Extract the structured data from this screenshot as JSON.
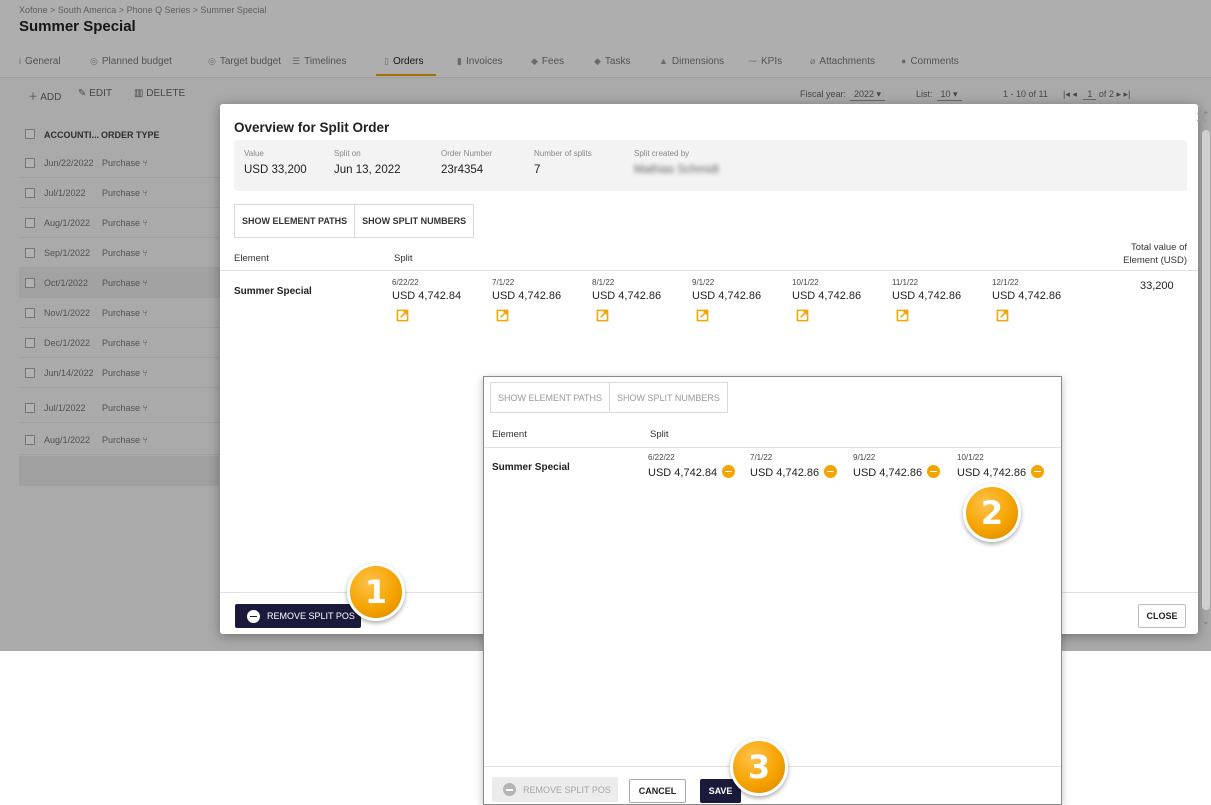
{
  "app": {
    "breadcrumb": "Xofone > South America > Phone Q Series > Summer Special",
    "title": "Summer Special",
    "tabs": [
      {
        "label": "General",
        "icon": "info-icon"
      },
      {
        "label": "Planned budget",
        "icon": "coin-icon"
      },
      {
        "label": "Target budget",
        "icon": "target-icon"
      },
      {
        "label": "Timelines",
        "icon": "timeline-icon"
      },
      {
        "label": "Orders",
        "icon": "document-icon",
        "active": true
      },
      {
        "label": "Invoices",
        "icon": "invoice-icon"
      },
      {
        "label": "Fees",
        "icon": "tag-icon"
      },
      {
        "label": "Tasks",
        "icon": "diamond-icon"
      },
      {
        "label": "Dimensions",
        "icon": "dimensions-icon"
      },
      {
        "label": "KPIs",
        "icon": "trend-icon"
      },
      {
        "label": "Attachments",
        "icon": "paperclip-icon"
      },
      {
        "label": "Comments",
        "icon": "comments-icon"
      }
    ],
    "toolbar": {
      "add": "ADD",
      "edit": "EDIT",
      "delete": "DELETE",
      "fiscal_year_label": "Fiscal year:",
      "fiscal_year_value": "2022",
      "list_label": "List:",
      "list_value": "10",
      "range": "1 - 10 of 11",
      "page": "1",
      "of_pages": "of 2"
    },
    "table": {
      "headers": [
        "ACCOUNTI...",
        "ORDER TYPE"
      ],
      "rows": [
        {
          "date": "Jun/22/2022",
          "type": "Purchase",
          "selected": false
        },
        {
          "date": "Jul/1/2022",
          "type": "Purchase",
          "selected": false
        },
        {
          "date": "Aug/1/2022",
          "type": "Purchase",
          "selected": false
        },
        {
          "date": "Sep/1/2022",
          "type": "Purchase",
          "selected": false
        },
        {
          "date": "Oct/1/2022",
          "type": "Purchase",
          "selected": true
        },
        {
          "date": "Nov/1/2022",
          "type": "Purchase",
          "selected": false
        },
        {
          "date": "Dec/1/2022",
          "type": "Purchase",
          "selected": false
        },
        {
          "date": "Jun/14/2022",
          "type": "Purchase",
          "selected": false
        },
        {
          "date": "Jul/1/2022",
          "type": "Purchase",
          "selected": false
        },
        {
          "date": "Aug/1/2022",
          "type": "Purchase",
          "selected": false
        }
      ]
    }
  },
  "dialog": {
    "title": "Overview for Split Order",
    "info": {
      "value_label": "Value",
      "value": "USD 33,200",
      "split_on_label": "Split on",
      "split_on": "Jun 13, 2022",
      "order_number_label": "Order Number",
      "order_number": "23r4354",
      "num_splits_label": "Number of splits",
      "num_splits": "7",
      "created_by_label": "Split created by",
      "created_by": "Mathias Schmidt"
    },
    "buttons": {
      "show_paths": "SHOW ELEMENT PATHS",
      "show_numbers": "SHOW SPLIT NUMBERS"
    },
    "columns": {
      "element": "Element",
      "split": "Split",
      "total_line1": "Total value of",
      "total_line2": "Element (USD)"
    },
    "row": {
      "element": "Summer Special",
      "total": "33,200",
      "splits": [
        {
          "date": "6/22/22",
          "amount": "USD 4,742.84"
        },
        {
          "date": "7/1/22",
          "amount": "USD 4,742.86"
        },
        {
          "date": "8/1/22",
          "amount": "USD 4,742.86"
        },
        {
          "date": "9/1/22",
          "amount": "USD 4,742.86"
        },
        {
          "date": "10/1/22",
          "amount": "USD 4,742.86"
        },
        {
          "date": "11/1/22",
          "amount": "USD 4,742.86"
        },
        {
          "date": "12/1/22",
          "amount": "USD 4,742.86"
        }
      ]
    },
    "footer": {
      "remove": "REMOVE SPLIT POS",
      "close": "CLOSE"
    }
  },
  "inset": {
    "buttons": {
      "show_paths": "SHOW ELEMENT PATHS",
      "show_numbers": "SHOW SPLIT NUMBERS"
    },
    "columns": {
      "element": "Element",
      "split": "Split"
    },
    "row": {
      "element": "Summer Special",
      "splits": [
        {
          "date": "6/22/22",
          "amount": "USD 4,742.84"
        },
        {
          "date": "7/1/22",
          "amount": "USD 4,742.86"
        },
        {
          "date": "9/1/22",
          "amount": "USD 4,742.86"
        },
        {
          "date": "10/1/22",
          "amount": "USD 4,742.86"
        }
      ]
    },
    "footer": {
      "remove": "REMOVE SPLIT POS",
      "cancel": "CANCEL",
      "save": "SAVE"
    }
  },
  "badges": [
    "1",
    "2",
    "3"
  ],
  "colors": {
    "accent": "#f5a300",
    "primary_button": "#1a1b3c",
    "edit_icon": "#f5a300"
  }
}
